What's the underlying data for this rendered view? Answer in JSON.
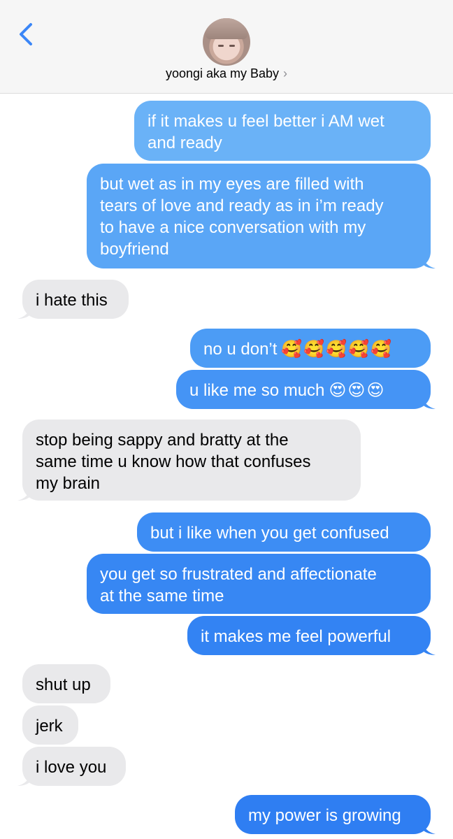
{
  "header": {
    "back_icon": "chevron-left-icon",
    "contact_name": "yoongi aka my Baby",
    "contact_chevron": "›"
  },
  "colors": {
    "sent_top": "#6ab2f7",
    "sent_bottom": "#2f7ef2",
    "received": "#e9e9eb",
    "header_bg": "#f6f6f6",
    "accent": "#3b86f7"
  },
  "messages": [
    {
      "from": "me",
      "text": "if it makes u feel better i AM wet\nand ready"
    },
    {
      "from": "me",
      "text": "but wet as in my eyes are filled with\ntears of love and ready as in i’m ready\nto have a nice conversation with my\nboyfriend"
    },
    {
      "from": "them",
      "text": "i hate this"
    },
    {
      "from": "me",
      "text": "no u don’t",
      "emoji": "🥰🥰🥰🥰🥰"
    },
    {
      "from": "me",
      "text": "u like me so much",
      "emoji": "😍😍😍"
    },
    {
      "from": "them",
      "text": "stop being sappy and bratty at the\nsame time u know how that confuses\nmy brain"
    },
    {
      "from": "me",
      "text": "but i like when you get confused"
    },
    {
      "from": "me",
      "text": "you get so frustrated and affectionate\nat the same time"
    },
    {
      "from": "me",
      "text": "it makes me feel powerful"
    },
    {
      "from": "them",
      "text": "shut up"
    },
    {
      "from": "them",
      "text": "jerk"
    },
    {
      "from": "them",
      "text": "i love you"
    },
    {
      "from": "me",
      "text": "my power is growing"
    }
  ]
}
